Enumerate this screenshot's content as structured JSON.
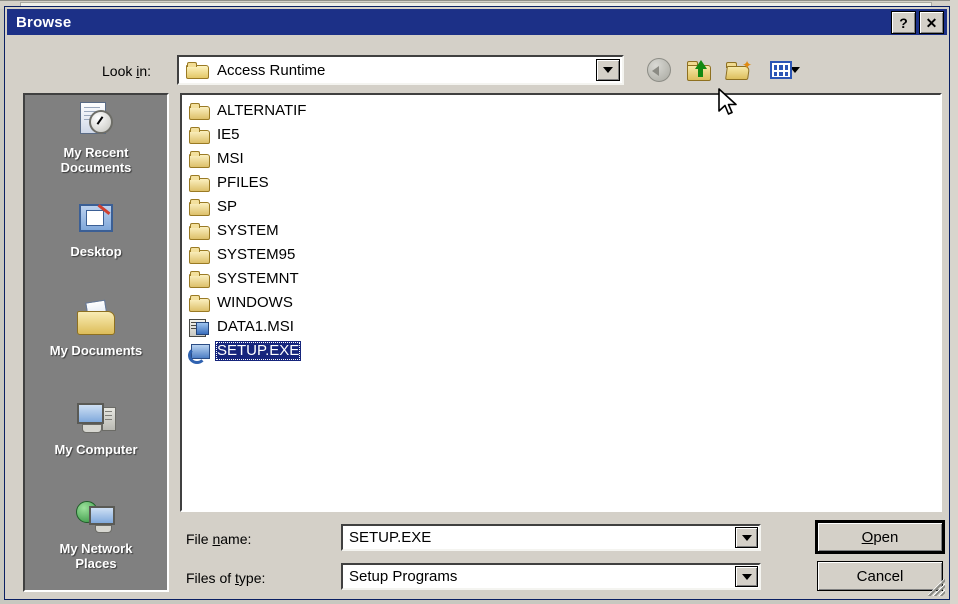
{
  "window": {
    "title": "Browse",
    "help_button": "?",
    "close_button": "✕"
  },
  "toolbar": {
    "lookin_label_a": "Look ",
    "lookin_label_u": "i",
    "lookin_label_b": "n:",
    "lookin_value": "Access Runtime",
    "icons": [
      {
        "name": "back-icon",
        "label": "Back"
      },
      {
        "name": "up-one-level-icon",
        "label": "Up One Level"
      },
      {
        "name": "create-new-folder-icon",
        "label": "Create New Folder"
      },
      {
        "name": "views-icon",
        "label": "Views"
      }
    ]
  },
  "places": [
    {
      "label": "My Recent\nDocuments",
      "label_line1": "My Recent",
      "label_line2": "Documents",
      "icon": "recent-documents-icon"
    },
    {
      "label": "Desktop",
      "label_line1": "Desktop",
      "label_line2": "",
      "icon": "desktop-icon"
    },
    {
      "label": "My Documents",
      "label_line1": "My Documents",
      "label_line2": "",
      "icon": "my-documents-icon"
    },
    {
      "label": "My Computer",
      "label_line1": "My Computer",
      "label_line2": "",
      "icon": "my-computer-icon"
    },
    {
      "label": "My Network Places",
      "label_line1": "My Network",
      "label_line2": "Places",
      "icon": "my-network-places-icon"
    }
  ],
  "files": [
    {
      "name": "ALTERNATIF",
      "type": "folder",
      "selected": false
    },
    {
      "name": "IE5",
      "type": "folder",
      "selected": false
    },
    {
      "name": "MSI",
      "type": "folder",
      "selected": false
    },
    {
      "name": "PFILES",
      "type": "folder",
      "selected": false
    },
    {
      "name": "SP",
      "type": "folder",
      "selected": false
    },
    {
      "name": "SYSTEM",
      "type": "folder",
      "selected": false
    },
    {
      "name": "SYSTEM95",
      "type": "folder",
      "selected": false
    },
    {
      "name": "SYSTEMNT",
      "type": "folder",
      "selected": false
    },
    {
      "name": "WINDOWS",
      "type": "folder",
      "selected": false
    },
    {
      "name": "DATA1.MSI",
      "type": "msi",
      "selected": false
    },
    {
      "name": "SETUP.EXE",
      "type": "exe",
      "selected": true
    }
  ],
  "fields": {
    "filename_label_a": "File ",
    "filename_label_u": "n",
    "filename_label_b": "ame:",
    "filename_value": "SETUP.EXE",
    "filetype_label_a": "Files of ",
    "filetype_label_u": "t",
    "filetype_label_b": "ype:",
    "filetype_value": "Setup Programs"
  },
  "buttons": {
    "open_a": "",
    "open_u": "O",
    "open_b": "pen",
    "cancel": "Cancel"
  },
  "colors": {
    "titlebar": "#1c3087",
    "dialog_face": "#d4d0c8",
    "places_bar": "#808080",
    "selection": "#16257c",
    "list_background": "#ffffff"
  }
}
